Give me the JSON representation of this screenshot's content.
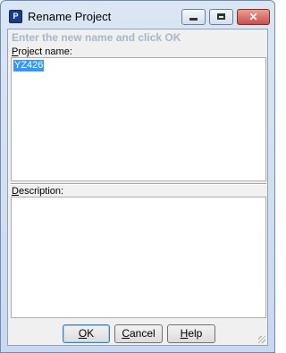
{
  "window": {
    "title": "Rename Project",
    "icon": "project-icon",
    "icon_text": "P",
    "controls": {
      "minimize": "minimize-icon",
      "maximize": "maximize-icon",
      "close": "close-icon",
      "close_glyph": "✕"
    }
  },
  "dialog": {
    "prompt": "Enter the new name and click OK",
    "project_name_label_accel": "P",
    "project_name_label_rest": "roject name:",
    "project_name_value": "YZ426",
    "description_label_accel": "D",
    "description_label_rest": "escription:",
    "description_value": ""
  },
  "buttons": {
    "ok_accel": "O",
    "ok_rest": "K",
    "cancel_accel": "C",
    "cancel_rest": "ancel",
    "help_accel": "H",
    "help_rest": "elp"
  },
  "colors": {
    "selection": "#3399ff",
    "prompt": "#a6b6cc",
    "titlebar": "#dbe6f4"
  }
}
